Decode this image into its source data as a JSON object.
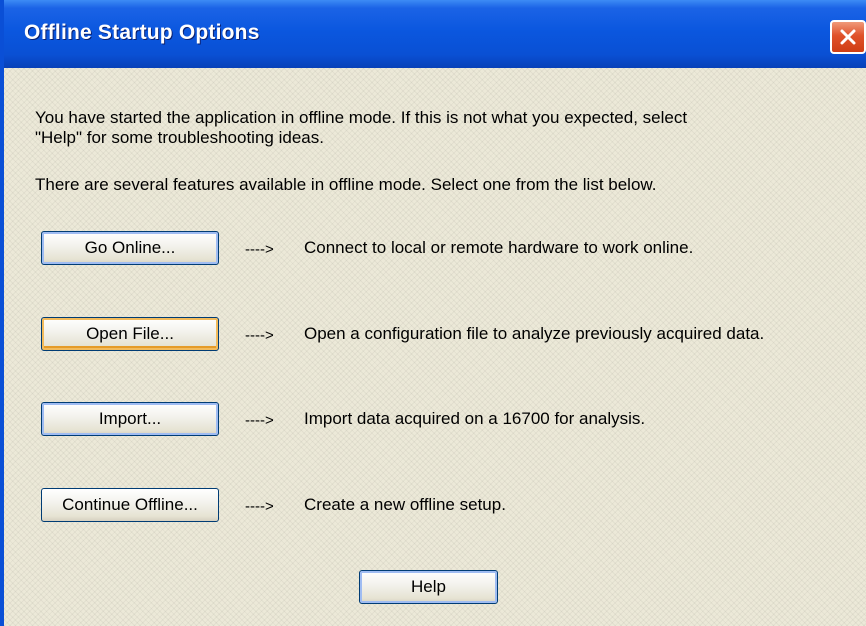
{
  "window": {
    "title": "Offline Startup Options",
    "close_icon": "close-icon"
  },
  "intro": {
    "line1": "You have started the application in offline mode. If this is not what you expected, select",
    "line2": "\"Help\" for some troubleshooting ideas.",
    "line3": "There are several features available in offline mode. Select one from the list below."
  },
  "options": [
    {
      "button": "Go Online...",
      "arrow": "---->",
      "description": "Connect to local or remote hardware to work online."
    },
    {
      "button": "Open File...",
      "arrow": "---->",
      "description": "Open a configuration file to analyze previously acquired data."
    },
    {
      "button": "Import...",
      "arrow": "---->",
      "description": "Import data acquired on a 16700 for analysis."
    },
    {
      "button": "Continue Offline...",
      "arrow": "---->",
      "description": "Create a new offline setup."
    }
  ],
  "help_button": "Help",
  "colors": {
    "titlebar": "#0a50d4",
    "window_bg": "#ece9d8",
    "close_button": "#e0522a",
    "focus_orange": "#f2bb5c",
    "focus_blue": "#9fbcf2"
  }
}
